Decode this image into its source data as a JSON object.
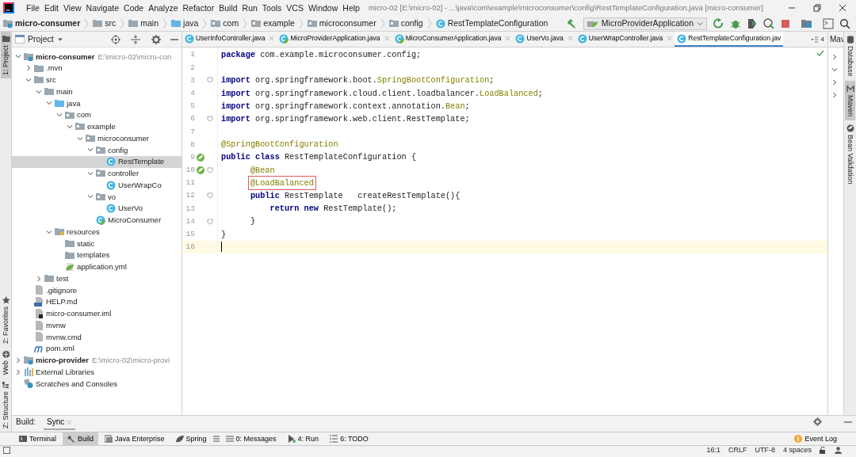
{
  "window": {
    "title": "micro-02 [E:\\micro-02] - ...\\java\\com\\example\\microconsumer\\config\\RestTemplateConfiguration.java [micro-consumer]"
  },
  "menu": [
    "File",
    "Edit",
    "View",
    "Navigate",
    "Code",
    "Analyze",
    "Refactor",
    "Build",
    "Run",
    "Tools",
    "VCS",
    "Window",
    "Help"
  ],
  "breadcrumbs": [
    {
      "label": "micro-consumer",
      "kind": "module"
    },
    {
      "label": "src",
      "kind": "folder"
    },
    {
      "label": "main",
      "kind": "folder"
    },
    {
      "label": "java",
      "kind": "source"
    },
    {
      "label": "com",
      "kind": "package"
    },
    {
      "label": "example",
      "kind": "package"
    },
    {
      "label": "microconsumer",
      "kind": "package"
    },
    {
      "label": "config",
      "kind": "package"
    },
    {
      "label": "RestTemplateConfiguration",
      "kind": "class"
    }
  ],
  "run_config": {
    "label": "MicroProviderApplication"
  },
  "left_tool_windows": [
    {
      "label": "1: Project",
      "kind": "project",
      "selected": true
    },
    {
      "label": "2: Favorites",
      "kind": "favorites",
      "selected": false
    },
    {
      "label": "Web",
      "kind": "web",
      "selected": false
    },
    {
      "label": "Z: Structure",
      "kind": "structure",
      "selected": false
    }
  ],
  "project_panel": {
    "title": "Project",
    "tree": [
      {
        "label": "micro-consumer",
        "kind": "module",
        "path": "E:\\micro-02\\micro-con",
        "expanded": true,
        "selected": false,
        "children": [
          {
            "label": ".mvn",
            "kind": "folder",
            "expanded": false,
            "selected": false
          },
          {
            "label": "src",
            "kind": "folder",
            "expanded": true,
            "selected": false,
            "children": [
              {
                "label": "main",
                "kind": "folder",
                "expanded": true,
                "selected": false,
                "children": [
                  {
                    "label": "java",
                    "kind": "source",
                    "expanded": true,
                    "selected": false,
                    "children": [
                      {
                        "label": "com",
                        "kind": "package",
                        "expanded": true,
                        "selected": false,
                        "children": [
                          {
                            "label": "example",
                            "kind": "package",
                            "expanded": true,
                            "selected": false,
                            "children": [
                              {
                                "label": "microconsumer",
                                "kind": "package",
                                "expanded": true,
                                "selected": false,
                                "children": [
                                  {
                                    "label": "config",
                                    "kind": "package",
                                    "expanded": true,
                                    "selected": false,
                                    "children": [
                                      {
                                        "label": "RestTemplate",
                                        "kind": "class",
                                        "selected": true
                                      }
                                    ]
                                  },
                                  {
                                    "label": "controller",
                                    "kind": "package",
                                    "expanded": true,
                                    "selected": false,
                                    "children": [
                                      {
                                        "label": "UserWrapCo",
                                        "kind": "class",
                                        "selected": false
                                      }
                                    ]
                                  },
                                  {
                                    "label": "vo",
                                    "kind": "package",
                                    "expanded": true,
                                    "selected": false,
                                    "children": [
                                      {
                                        "label": "UserVo",
                                        "kind": "class",
                                        "selected": false
                                      }
                                    ]
                                  },
                                  {
                                    "label": "MicroConsumer",
                                    "kind": "spring-class",
                                    "selected": false
                                  }
                                ]
                              }
                            ]
                          }
                        ]
                      }
                    ]
                  },
                  {
                    "label": "resources",
                    "kind": "resources",
                    "expanded": true,
                    "selected": false,
                    "children": [
                      {
                        "label": "static",
                        "kind": "folder",
                        "selected": false
                      },
                      {
                        "label": "templates",
                        "kind": "folder",
                        "selected": false
                      },
                      {
                        "label": "application.yml",
                        "kind": "yml",
                        "selected": false
                      }
                    ]
                  }
                ]
              },
              {
                "label": "test",
                "kind": "folder",
                "expanded": false,
                "selected": false
              }
            ]
          },
          {
            "label": ".gitignore",
            "kind": "file",
            "selected": false
          },
          {
            "label": "HELP.md",
            "kind": "markdown",
            "selected": false
          },
          {
            "label": "micro-consumer.iml",
            "kind": "iml",
            "selected": false
          },
          {
            "label": "mvnw",
            "kind": "file",
            "selected": false
          },
          {
            "label": "mvnw.cmd",
            "kind": "file",
            "selected": false
          },
          {
            "label": "pom.xml",
            "kind": "maven",
            "selected": false
          }
        ]
      },
      {
        "label": "micro-provider",
        "kind": "module",
        "path": "E:\\micro-02\\micro-provi",
        "expanded": false,
        "selected": false
      },
      {
        "label": "External Libraries",
        "kind": "libraries",
        "expanded": false,
        "selected": false
      },
      {
        "label": "Scratches and Consoles",
        "kind": "scratches",
        "selected": false
      }
    ]
  },
  "editor_tabs": [
    {
      "label": "UserInfoController.java",
      "kind": "class",
      "selected": false
    },
    {
      "label": "MicroProviderApplication.java",
      "kind": "spring-class",
      "selected": false
    },
    {
      "label": "MicroConsumerApplication.java",
      "kind": "spring-class",
      "selected": false
    },
    {
      "label": "UserVo.java",
      "kind": "class",
      "selected": false
    },
    {
      "label": "UserWrapController.java",
      "kind": "class",
      "selected": false
    },
    {
      "label": "RestTemplateConfiguration.jav",
      "kind": "class",
      "selected": true
    }
  ],
  "tab_overflow": "4",
  "code_lines": [
    {
      "number": "1",
      "tokens": [
        {
          "kind": "keyword",
          "text": "package"
        },
        {
          "kind": "plain",
          "text": " com.example.microconsumer.config;"
        }
      ]
    },
    {
      "number": "2"
    },
    {
      "number": "3",
      "fold": true,
      "tokens": [
        {
          "kind": "keyword",
          "text": "import"
        },
        {
          "kind": "plain",
          "text": " org.springframework.boot."
        },
        {
          "kind": "annotation",
          "text": "SpringBootConfiguration"
        },
        {
          "kind": "plain",
          "text": ";"
        }
      ]
    },
    {
      "number": "4",
      "tokens": [
        {
          "kind": "keyword",
          "text": "import"
        },
        {
          "kind": "plain",
          "text": " org.springframework.cloud.client.loadbalancer."
        },
        {
          "kind": "annotation",
          "text": "LoadBalanced"
        },
        {
          "kind": "plain",
          "text": ";"
        }
      ]
    },
    {
      "number": "5",
      "tokens": [
        {
          "kind": "keyword",
          "text": "import"
        },
        {
          "kind": "plain",
          "text": " org.springframework.context.annotation."
        },
        {
          "kind": "annotation",
          "text": "Bean"
        },
        {
          "kind": "plain",
          "text": ";"
        }
      ]
    },
    {
      "number": "6",
      "fold": true,
      "tokens": [
        {
          "kind": "keyword",
          "text": "import"
        },
        {
          "kind": "plain",
          "text": " org.springframework.web.client.RestTemplate;"
        }
      ]
    },
    {
      "number": "7"
    },
    {
      "number": "8",
      "tokens": [
        {
          "kind": "annotation",
          "text": "@SpringBootConfiguration"
        }
      ]
    },
    {
      "number": "9",
      "bean_marker": true,
      "tokens": [
        {
          "kind": "keyword",
          "text": "public class"
        },
        {
          "kind": "plain",
          "text": " RestTemplateConfiguration {"
        }
      ]
    },
    {
      "number": "10",
      "bean_marker": true,
      "fold": true,
      "tokens": [
        {
          "kind": "annotation",
          "text": "      @Bean"
        }
      ]
    },
    {
      "number": "11",
      "boxed": true,
      "tokens": [
        {
          "kind": "annotation",
          "text": "      @LoadBalanced"
        }
      ]
    },
    {
      "number": "12",
      "fold": true,
      "tokens": [
        {
          "kind": "keyword",
          "text": "      public"
        },
        {
          "kind": "plain",
          "text": " RestTemplate   createRestTemplate(){"
        }
      ]
    },
    {
      "number": "13",
      "tokens": [
        {
          "kind": "keyword",
          "text": "          return new"
        },
        {
          "kind": "plain",
          "text": " RestTemplate();"
        }
      ]
    },
    {
      "number": "14",
      "fold": true,
      "tokens": [
        {
          "kind": "plain",
          "text": "      }"
        }
      ]
    },
    {
      "number": "15",
      "tokens": [
        {
          "kind": "plain",
          "text": "}"
        }
      ]
    },
    {
      "number": "16",
      "current": true
    }
  ],
  "maven_panel": {
    "title": "Mav"
  },
  "right_tool_windows": [
    {
      "label": "Database",
      "kind": "database",
      "selected": false
    },
    {
      "label": "Maven",
      "kind": "maven",
      "selected": true
    },
    {
      "label": "Bean Validation",
      "kind": "bean",
      "selected": false
    }
  ],
  "build_panel": {
    "title": "Build:",
    "tabs": [
      {
        "label": "Sync",
        "selected": true
      }
    ]
  },
  "bottom_tool_windows": [
    {
      "label": "Terminal",
      "kind": "terminal",
      "selected": false
    },
    {
      "label": "Build",
      "kind": "build",
      "selected": true
    },
    {
      "label": "Java Enterprise",
      "kind": "enterprise",
      "selected": false
    },
    {
      "label": "Spring",
      "kind": "spring",
      "selected": false
    },
    {
      "label": "0: Messages",
      "kind": "messages",
      "selected": false
    },
    {
      "label": "4: Run",
      "kind": "run",
      "selected": false
    },
    {
      "label": "6: TODO",
      "kind": "todo",
      "selected": false
    }
  ],
  "event_log": {
    "label": "Event Log"
  },
  "status_bar": {
    "position": "16:1",
    "line_ending": "CRLF",
    "encoding": "UTF-8",
    "indent": "4 spaces"
  }
}
